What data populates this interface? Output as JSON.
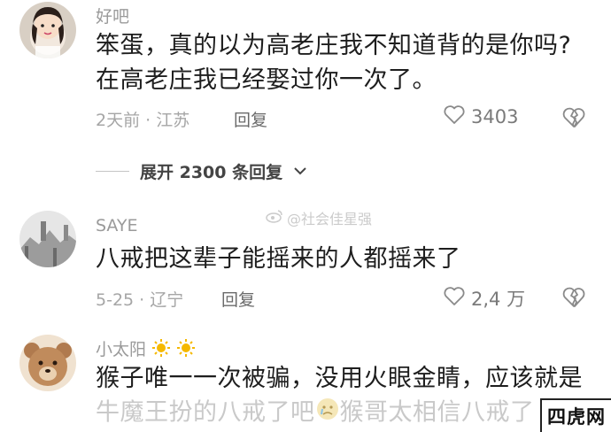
{
  "comments": [
    {
      "username": "好吧",
      "lines": [
        "笨蛋，真的以为高老庄我不知道背的是你吗?",
        "在高老庄我已经娶过你一次了。"
      ],
      "time_location": "2天前 · 江苏",
      "reply_label": "回复",
      "likes": "3403",
      "avatar_icon": "avatar-girl"
    },
    {
      "username": "SAYE",
      "lines": [
        "八戒把这辈子能摇来的人都摇来了"
      ],
      "time_location": "5-25 · 辽宁",
      "reply_label": "回复",
      "likes": "2,4 万",
      "avatar_icon": "avatar-landscape"
    },
    {
      "username": "小太阳",
      "username_emojis": [
        "sun-emoji",
        "sun-emoji"
      ],
      "lines": [
        "猴子唯一一次被骗，没用火眼金睛，应该就是"
      ],
      "faded_line_part1": "牛魔王扮的八戒了吧",
      "faded_line_part2": "猴哥太相信八戒了",
      "avatar_icon": "avatar-bear"
    }
  ],
  "expand_replies": {
    "label": "展开 2300 条回复"
  },
  "watermark": {
    "text": "@社会佳星强"
  },
  "corner_logo": {
    "text": "四虎网"
  },
  "colors": {
    "username": "#9a9a9a",
    "text": "#1e1e1e",
    "meta": "#a6a6a6",
    "faded": "#c9c9c9"
  }
}
